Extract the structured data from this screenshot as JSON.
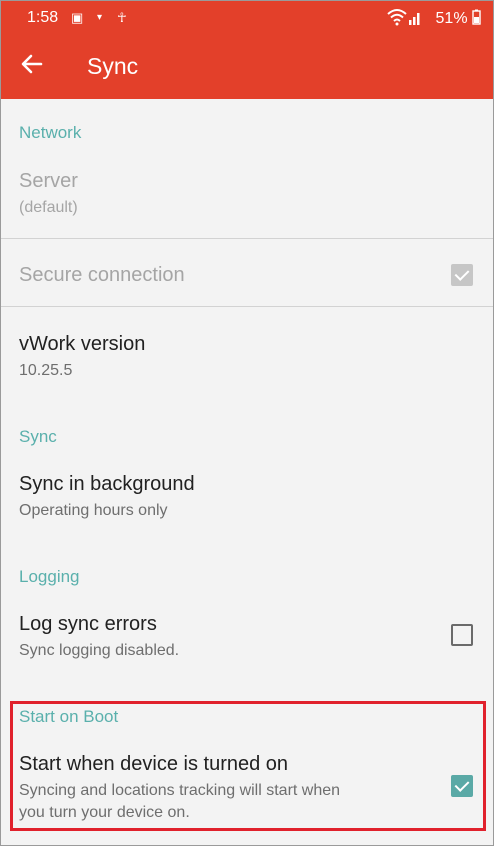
{
  "status_bar": {
    "time": "1:58",
    "battery": "51%",
    "icons": [
      "notification-icon",
      "dropdown-icon",
      "accessibility-icon",
      "wifi-icon",
      "signal-icon"
    ]
  },
  "app_bar": {
    "title": "Sync",
    "back_icon": "back-arrow-icon"
  },
  "colors": {
    "accent": "#e3402a",
    "section_header": "#5ab0ac",
    "checkbox_checked": "#5aa9a6",
    "highlight_border": "#e0212c"
  },
  "sections": {
    "network": {
      "header": "Network",
      "server_title": "Server",
      "server_value": "(default)",
      "secure_title": "Secure connection",
      "secure_checked": true,
      "version_title": "vWork version",
      "version_value": "10.25.5"
    },
    "sync": {
      "header": "Sync",
      "bg_title": "Sync in background",
      "bg_value": "Operating hours only"
    },
    "logging": {
      "header": "Logging",
      "log_title": "Log sync errors",
      "log_value": "Sync logging disabled.",
      "log_checked": false
    },
    "boot": {
      "header": "Start on Boot",
      "start_title": "Start when device is turned on",
      "start_desc_line1": "Syncing and locations tracking will start when",
      "start_desc_line2": "you turn your device on.",
      "start_checked": true
    }
  }
}
